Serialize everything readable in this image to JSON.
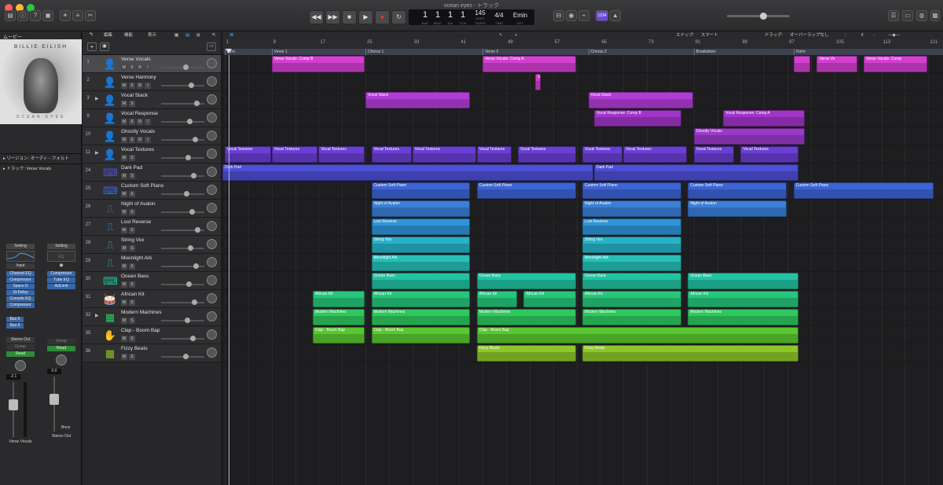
{
  "window": {
    "title": "ocean eyes - トラック"
  },
  "transport": {
    "rewind": "◀◀",
    "forward": "▶▶",
    "stop": "■",
    "play": "▶",
    "record": "●",
    "cycle": "↻",
    "bar": "1",
    "beat": "1",
    "div": "1",
    "tick": "1",
    "bar_label": "BAR",
    "beat_label": "BEAT",
    "div_label": "DIV",
    "tick_label": "TICK",
    "tempo": "145",
    "tempo_mode": "KEEP",
    "tempo_label": "TEMPO",
    "sig": "4/4",
    "sig_label": "TIME",
    "key": "Emin",
    "key_label": "KEY",
    "lcd_mode": "1234"
  },
  "inspector": {
    "header": "ムービー",
    "album_artist": "BILLIE EILISH",
    "album_title": "OCEAN EYES",
    "region_label": "リージョン:",
    "region_value": "オーディ···フォルト",
    "track_label": "トラック:",
    "track_value": "Verse Vocals",
    "strip1": {
      "setting": "Setting",
      "eq": "EQ",
      "input": "Input",
      "plugins": [
        "Channel EQ",
        "Compressor",
        "Space D",
        "St-Delay",
        "Console EQ",
        "Compressor"
      ],
      "sends": [
        "Bus 5",
        "Bus 6"
      ],
      "output": "Stereo Out",
      "mode": "Group",
      "auto": "Read",
      "volume": "-2.1",
      "name": "Verse Vocals"
    },
    "strip2": {
      "setting": "Setting",
      "eq": "EQ",
      "plugins": [
        "Compressor",
        "Tube EQ",
        "AdLimit"
      ],
      "mode": "Group",
      "auto": "Read",
      "volume": "0.0",
      "bounce": "Bnce",
      "name": "Stereo Out"
    }
  },
  "arrange_toolbar": {
    "edit": "編集",
    "function": "機能",
    "view": "表示",
    "snap_label": "スナップ:",
    "snap_value": "スマート",
    "drag_label": "ドラッグ:",
    "drag_value": "オーバーラップなし"
  },
  "ruler": {
    "bars": [
      "1",
      "9",
      "17",
      "25",
      "33",
      "41",
      "49",
      "57",
      "65",
      "73",
      "81",
      "89",
      "97",
      "105",
      "113",
      "121"
    ],
    "markers": [
      {
        "name": "Intro",
        "bar": 1
      },
      {
        "name": "Verse 1",
        "bar": 9
      },
      {
        "name": "Chorus 1",
        "bar": 25
      },
      {
        "name": "Verse 2",
        "bar": 45
      },
      {
        "name": "Chorus 2",
        "bar": 63
      },
      {
        "name": "Breakdown",
        "bar": 81
      },
      {
        "name": "Outro",
        "bar": 98
      }
    ]
  },
  "tracks": [
    {
      "num": "1",
      "name": "Verse Vocals",
      "icon": "person-icon",
      "glyph": "👤",
      "color": "#d43fd0",
      "selected": true,
      "rec": true
    },
    {
      "num": "2",
      "name": "Verse Harmony",
      "icon": "person-icon",
      "glyph": "👤",
      "color": "#d43fd0",
      "rec": true
    },
    {
      "num": "3",
      "name": "Vocal Stack",
      "icon": "person-icon",
      "glyph": "👤",
      "color": "#b23dd6",
      "folder": true
    },
    {
      "num": "9",
      "name": "Vocal Response",
      "icon": "person-icon",
      "glyph": "👤",
      "color": "#a035c8",
      "rec": true
    },
    {
      "num": "10",
      "name": "Ghostly Vocals",
      "icon": "person-icon",
      "glyph": "👤",
      "color": "#9a3ac9",
      "rec": true
    },
    {
      "num": "11",
      "name": "Vocal Textures",
      "icon": "person-icon",
      "glyph": "👤",
      "color": "#6a3fd4",
      "folder": true
    },
    {
      "num": "24",
      "name": "Dark Pad",
      "icon": "keyboard-icon",
      "glyph": "⌨",
      "color": "#4d4fd6"
    },
    {
      "num": "25",
      "name": "Custom Soft Piano",
      "icon": "keyboard-icon",
      "glyph": "⌨",
      "color": "#3d64d6"
    },
    {
      "num": "26",
      "name": "Night of Avalon",
      "icon": "synth-icon",
      "glyph": "⎍",
      "color": "#3a7fd8"
    },
    {
      "num": "27",
      "name": "Lost Reverse",
      "icon": "synth-icon",
      "glyph": "⎍",
      "color": "#2f95d8"
    },
    {
      "num": "28",
      "name": "String Vox",
      "icon": "synth-icon",
      "glyph": "⎍",
      "color": "#27b2c8"
    },
    {
      "num": "29",
      "name": "Moonlight Ark",
      "icon": "synth-icon",
      "glyph": "⎍",
      "color": "#25c0b8"
    },
    {
      "num": "30",
      "name": "Ocean Bass",
      "icon": "keyboard-icon",
      "glyph": "⌨",
      "color": "#22c3a2"
    },
    {
      "num": "31",
      "name": "African Kit",
      "icon": "drum-icon",
      "glyph": "🥁",
      "color": "#26c77c"
    },
    {
      "num": "32",
      "name": "Modern Machines",
      "icon": "drum-machine-icon",
      "glyph": "▦",
      "color": "#2ec85e",
      "folder": true
    },
    {
      "num": "35",
      "name": "Clap - Boom Bap",
      "icon": "hand-icon",
      "glyph": "✋",
      "color": "#58c730"
    },
    {
      "num": "36",
      "name": "Fizzy Beats",
      "icon": "drum-machine-icon",
      "glyph": "▦",
      "color": "#8cc62a"
    }
  ],
  "regions": [
    [
      {
        "n": "Verse Vocals: Comp B",
        "s": 9,
        "e": 25
      },
      {
        "n": "Verse Vocals: Comp A",
        "s": 45,
        "e": 61
      },
      {
        "n": "",
        "s": 98,
        "e": 101
      },
      {
        "n": "Verse Vo",
        "s": 102,
        "e": 109
      },
      {
        "n": "Verse Vocals: Comp",
        "s": 110,
        "e": 121
      }
    ],
    [
      {
        "n": "V",
        "s": 54,
        "e": 55
      }
    ],
    [
      {
        "n": "Vocal Stack",
        "s": 25,
        "e": 43
      },
      {
        "n": "Vocal Stack",
        "s": 63,
        "e": 81
      }
    ],
    [
      {
        "n": "Vocal Response: Comp B",
        "s": 64,
        "e": 79
      },
      {
        "n": "Vocal Response: Comp A",
        "s": 86,
        "e": 100
      }
    ],
    [
      {
        "n": "Ghostly Vocals",
        "s": 81,
        "e": 100
      }
    ],
    [
      {
        "n": "Vocal Textures",
        "s": 1,
        "e": 9
      },
      {
        "n": "Vocal Textures",
        "s": 9,
        "e": 17
      },
      {
        "n": "Vocal Textures",
        "s": 17,
        "e": 25
      },
      {
        "n": "Vocal Textures",
        "s": 26,
        "e": 33
      },
      {
        "n": "Vocal Textures",
        "s": 33,
        "e": 44
      },
      {
        "n": "Vocal Textures",
        "s": 44,
        "e": 50
      },
      {
        "n": "Vocal Textures",
        "s": 51,
        "e": 61
      },
      {
        "n": "Vocal Textures",
        "s": 62,
        "e": 69
      },
      {
        "n": "Vocal Textures",
        "s": 69,
        "e": 80
      },
      {
        "n": "Vocal Textures",
        "s": 81,
        "e": 88
      },
      {
        "n": "Vocal Textures",
        "s": 89,
        "e": 99
      }
    ],
    [
      {
        "n": "Dark Pad",
        "s": 0,
        "e": 64
      },
      {
        "n": "Dark Pad",
        "s": 64,
        "e": 99
      }
    ],
    [
      {
        "n": "Custom Soft Piano",
        "s": 26,
        "e": 43
      },
      {
        "n": "Custom Soft Piano",
        "s": 44,
        "e": 61
      },
      {
        "n": "Custom Soft Piano",
        "s": 62,
        "e": 79
      },
      {
        "n": "Custom Soft Piano",
        "s": 80,
        "e": 97
      },
      {
        "n": "Custom Soft Piano",
        "s": 98,
        "e": 122
      }
    ],
    [
      {
        "n": "Night of Avalon",
        "s": 26,
        "e": 43
      },
      {
        "n": "Night of Avalon",
        "s": 62,
        "e": 79
      },
      {
        "n": "Night of Avalon",
        "s": 80,
        "e": 97
      }
    ],
    [
      {
        "n": "Lost Reverse",
        "s": 26,
        "e": 43
      },
      {
        "n": "Lost Reverse",
        "s": 62,
        "e": 79
      }
    ],
    [
      {
        "n": "String Vox",
        "s": 26,
        "e": 43
      },
      {
        "n": "String Vox",
        "s": 62,
        "e": 79
      }
    ],
    [
      {
        "n": "Moonlight Ark",
        "s": 26,
        "e": 43
      },
      {
        "n": "Moonlight Ark",
        "s": 62,
        "e": 79
      }
    ],
    [
      {
        "n": "Ocean Bass",
        "s": 26,
        "e": 43
      },
      {
        "n": "Ocean Bass",
        "s": 44,
        "e": 61
      },
      {
        "n": "Ocean Bass",
        "s": 62,
        "e": 79
      },
      {
        "n": "Ocean Bass",
        "s": 80,
        "e": 99
      }
    ],
    [
      {
        "n": "African Kit",
        "s": 16,
        "e": 25
      },
      {
        "n": "African Kit",
        "s": 26,
        "e": 43
      },
      {
        "n": "African Kit",
        "s": 44,
        "e": 51
      },
      {
        "n": "African Kit",
        "s": 52,
        "e": 61
      },
      {
        "n": "African Kit",
        "s": 62,
        "e": 79
      },
      {
        "n": "African Kit",
        "s": 80,
        "e": 99
      }
    ],
    [
      {
        "n": "Modern Machines",
        "s": 16,
        "e": 25
      },
      {
        "n": "Modern Machines",
        "s": 26,
        "e": 43
      },
      {
        "n": "Modern Machines",
        "s": 44,
        "e": 61
      },
      {
        "n": "Modern Machines",
        "s": 62,
        "e": 79
      },
      {
        "n": "Modern Machines",
        "s": 80,
        "e": 99
      }
    ],
    [
      {
        "n": "Clap - Boom Bap",
        "s": 16,
        "e": 25
      },
      {
        "n": "Clap - Boom Bap",
        "s": 26,
        "e": 43
      },
      {
        "n": "Clap - Boom Bap",
        "s": 44,
        "e": 99
      }
    ],
    [
      {
        "n": "Fizzy Beats",
        "s": 44,
        "e": 61
      },
      {
        "n": "Fizzy Beats",
        "s": 62,
        "e": 99
      }
    ]
  ]
}
